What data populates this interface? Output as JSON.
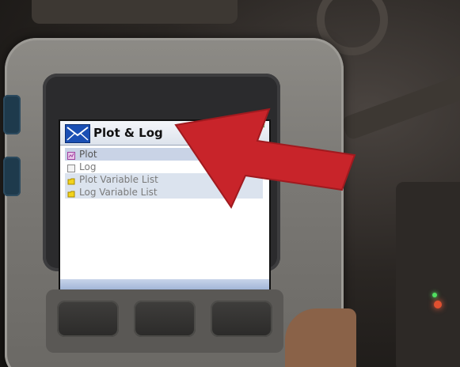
{
  "screen": {
    "title": "Plot & Log",
    "menu_items": [
      {
        "label": "Plot",
        "state": "selected"
      },
      {
        "label": "Log",
        "state": "normal"
      },
      {
        "label": "Plot Variable List",
        "state": "normal"
      },
      {
        "label": "Log Variable List",
        "state": "normal"
      }
    ]
  },
  "colors": {
    "annotation_arrow": "#c8242a",
    "title_icon": "#1a4fb4",
    "selection": "#c9d3e6"
  },
  "icons": {
    "app_icon": "envelope-icon",
    "plot_icon": "plot-icon",
    "log_icon": "log-icon",
    "variable_list_icon": "folder-icon"
  }
}
